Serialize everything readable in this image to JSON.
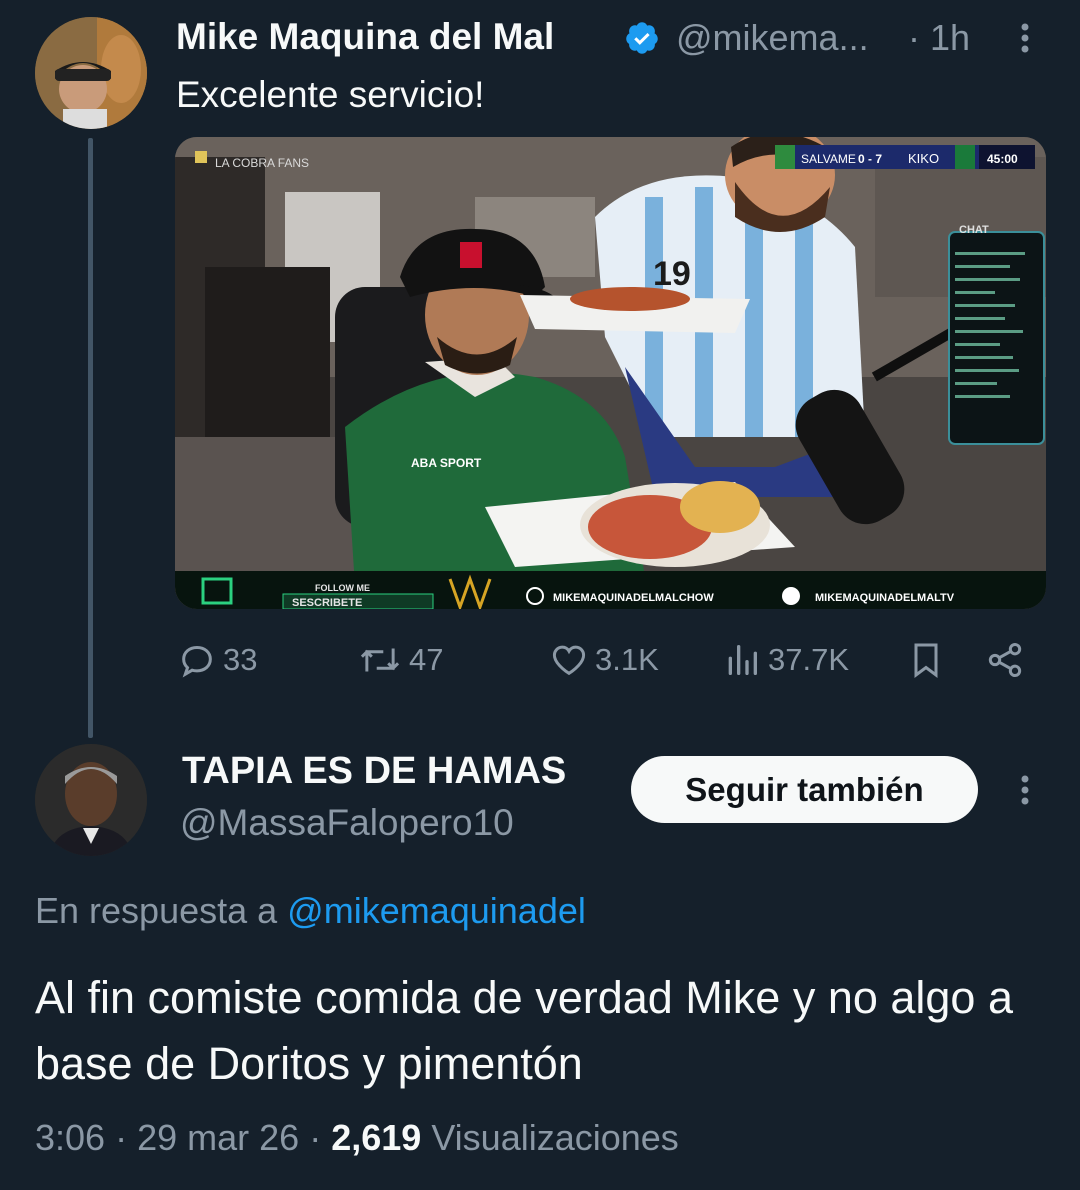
{
  "tweet1": {
    "author_name": "Mike Maquina del Mal",
    "handle": "@mikema...",
    "time": "· 1h",
    "text": "Excelente servicio!",
    "media": {
      "watermark": "LA COBRA FANS",
      "scoreboard": {
        "left_team": "SALVAME",
        "score": "0 - 7",
        "right_team": "KIKO",
        "clock": "45:00"
      },
      "chat_label": "CHAT",
      "jersey_number": "19",
      "follow_label": "FOLLOW ME",
      "subscribe_label": "SESCRIBETE",
      "instagram_handle": "MIKEMAQUINADELMALCHOW",
      "tiktok_handle": "MIKEMAQUINADELMALTV",
      "shirt_logo": "ABA SPORT"
    },
    "actions": {
      "replies": "33",
      "retweets": "47",
      "likes": "3.1K",
      "views": "37.7K"
    }
  },
  "tweet2": {
    "author_name": "TAPIA ES DE HAMAS",
    "handle": "@MassaFalopero10",
    "follow_label": "Seguir también",
    "reply_prefix": "En respuesta a",
    "reply_mention": "@mikemaquinadel",
    "text": "Al fin comiste comida de verdad Mike y no algo a base de Doritos y pimentón",
    "time": "3:06",
    "date": "29 mar 26",
    "views_count": "2,619",
    "views_label": "Visualizaciones"
  },
  "colors": {
    "background": "#15202b",
    "text_primary": "#f7f9f9",
    "text_secondary": "#8b98a5",
    "accent": "#1d9bf0"
  }
}
